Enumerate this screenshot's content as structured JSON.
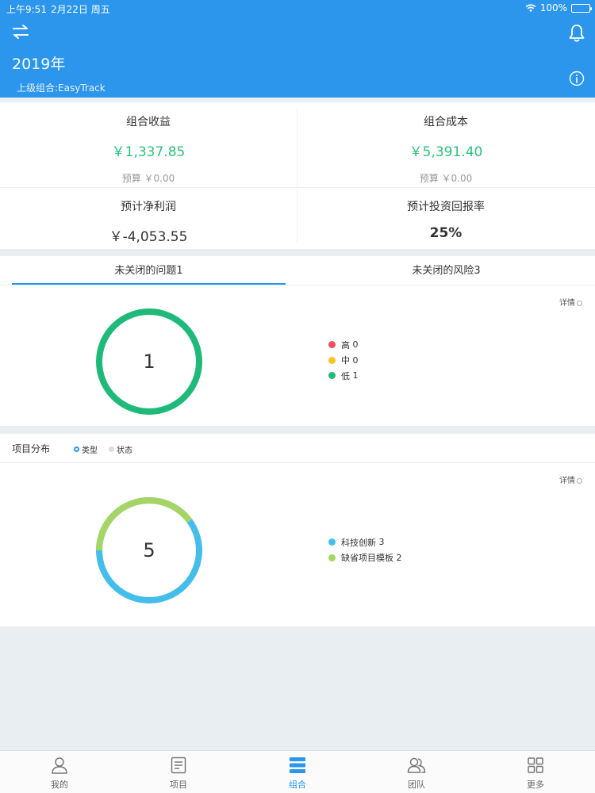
{
  "status_bar": {
    "time": "上午9:51",
    "date": "2月22日 周五",
    "battery": "100%"
  },
  "header": {
    "title": "2019年",
    "parent_group": "上级组合:EasyTrack"
  },
  "stats": {
    "income": {
      "label": "组合收益",
      "value": "￥1,337.85",
      "budget": "预算 ￥0.00"
    },
    "cost": {
      "label": "组合成本",
      "value": "￥5,391.40",
      "budget": "预算 ￥0.00"
    },
    "net_profit": {
      "label": "预计净利润",
      "value": "￥-4,053.55"
    },
    "roi": {
      "label": "预计投资回报率",
      "value": "25%"
    }
  },
  "issues": {
    "tabs": [
      {
        "label": "未关闭的问题1"
      },
      {
        "label": "未关闭的风险3"
      }
    ],
    "details_label": "详情",
    "total": "1",
    "legend": [
      {
        "label": "高",
        "count": "0",
        "color": "#ef4f5e"
      },
      {
        "label": "中",
        "count": "0",
        "color": "#f7c31c"
      },
      {
        "label": "低",
        "count": "1",
        "color": "#1fb97a"
      }
    ],
    "ring_color": "#1fb97a"
  },
  "distribution": {
    "title": "项目分布",
    "options": [
      {
        "label": "类型",
        "selected": true
      },
      {
        "label": "状态",
        "selected": false
      }
    ],
    "details_label": "详情",
    "total": "5",
    "legend": [
      {
        "label": "科技创新",
        "count": "3",
        "color": "#45bdea"
      },
      {
        "label": "缺省项目模板",
        "count": "2",
        "color": "#a5d665"
      }
    ]
  },
  "tabbar": {
    "items": [
      {
        "label": "我的",
        "icon": "person-icon"
      },
      {
        "label": "项目",
        "icon": "clipboard-icon"
      },
      {
        "label": "组合",
        "icon": "stack-icon",
        "active": true
      },
      {
        "label": "团队",
        "icon": "team-icon"
      },
      {
        "label": "更多",
        "icon": "grid-icon"
      }
    ]
  },
  "colors": {
    "primary": "#2b96ec",
    "money_green": "#2ec07b"
  }
}
